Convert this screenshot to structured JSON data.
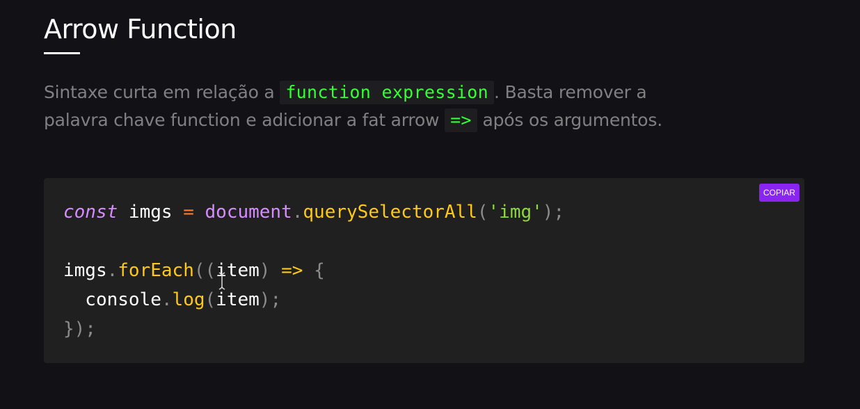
{
  "heading": {
    "title": "Arrow Function"
  },
  "intro": {
    "part1": "Sintaxe curta em relação a ",
    "code1": "function expression",
    "part2": ". Basta remover a palavra chave function e adicionar a fat arrow ",
    "code2": "=>",
    "part3": " após os argumentos."
  },
  "code_block": {
    "copy_label": "COPIAR",
    "lines": [
      [
        {
          "t": "const",
          "c": "kw"
        },
        {
          "t": " imgs ",
          "c": "plain"
        },
        {
          "t": "=",
          "c": "op"
        },
        {
          "t": " ",
          "c": "plain"
        },
        {
          "t": "document",
          "c": "obj"
        },
        {
          "t": ".",
          "c": "punc"
        },
        {
          "t": "querySelectorAll",
          "c": "fn"
        },
        {
          "t": "(",
          "c": "punc"
        },
        {
          "t": "'img'",
          "c": "str"
        },
        {
          "t": ");",
          "c": "punc"
        }
      ],
      [],
      [
        {
          "t": "imgs",
          "c": "plain"
        },
        {
          "t": ".",
          "c": "punc"
        },
        {
          "t": "forEach",
          "c": "fn"
        },
        {
          "t": "((",
          "c": "punc"
        },
        {
          "t": "item",
          "c": "plain"
        },
        {
          "t": ")",
          "c": "punc"
        },
        {
          "t": " ",
          "c": "plain"
        },
        {
          "t": "=>",
          "c": "fn"
        },
        {
          "t": " ",
          "c": "plain"
        },
        {
          "t": "{",
          "c": "punc"
        }
      ],
      [
        {
          "t": "  console",
          "c": "plain"
        },
        {
          "t": ".",
          "c": "punc"
        },
        {
          "t": "log",
          "c": "fn"
        },
        {
          "t": "(",
          "c": "punc"
        },
        {
          "t": "item",
          "c": "plain"
        },
        {
          "t": ");",
          "c": "punc"
        }
      ],
      [
        {
          "t": "});",
          "c": "punc"
        }
      ]
    ]
  },
  "colors": {
    "background": "#121116",
    "code_background": "#202020",
    "copy_button": "#8a24f0",
    "inline_code_text": "#33ff33"
  },
  "icons": {
    "cursor": "text-cursor-icon"
  }
}
